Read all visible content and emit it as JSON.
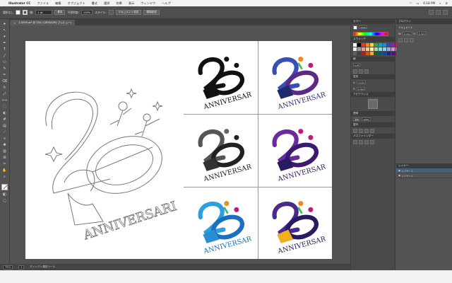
{
  "menubar": {
    "app_name": "Illustrator CC",
    "items": [
      "ファイル",
      "編集",
      "オブジェクト",
      "書式",
      "選択",
      "効果",
      "表示",
      "ウィンドウ",
      "ヘルプ"
    ],
    "time": "6:18 PM"
  },
  "controlbar": {
    "selection_label": "選択なし",
    "stroke_label": "線:",
    "stroke_value": "1 pt",
    "style_label": "基本",
    "opacity_label": "不透明度:",
    "opacity_value": "100%",
    "style2_label": "スタイル:",
    "doc_setup": "ドキュメント設定",
    "prefs": "環境設定"
  },
  "document_tab": {
    "title": "1-0000.ai* @ 75% (CMYK/GPU プレビュー)",
    "close": "×"
  },
  "logo": {
    "text": "ANNIVERSARI",
    "number_left": "2",
    "number_right": "0"
  },
  "panels": {
    "properties_header": "プロパティ",
    "layers_header": "レイヤー",
    "swatches_header": "スウォッチ",
    "color_header": "カラー",
    "appearance_header": "アピアランス",
    "transform_header": "変形",
    "align_header": "整列",
    "pathfinder_header": "パスファインダー",
    "opacity_header": "透明",
    "opacity_value": "100%",
    "blend_mode": "通常",
    "stroke_header": "線",
    "stroke_weight": "1 pt",
    "layer1_name": "レイヤー 1",
    "layer2_name": "レイヤー 2",
    "x_label": "X:",
    "x_value": "0 mm",
    "y_label": "Y:",
    "y_value": "0 mm",
    "w_label": "W:",
    "w_value": "0 mm",
    "h_label": "H:",
    "h_value": "0 mm",
    "doc_label": "ドキュメント",
    "color_mode": "CMYK"
  },
  "statusbar": {
    "zoom": "75%",
    "page": "1",
    "tool": "ダイレクト選択ツール"
  },
  "colors": {
    "accent_blue": "#3a4fb5",
    "accent_purple": "#5a2a86",
    "magenta": "#c2197d",
    "green": "#3dbb4c",
    "orange": "#f08a1a",
    "cyan": "#2aa0dd"
  }
}
